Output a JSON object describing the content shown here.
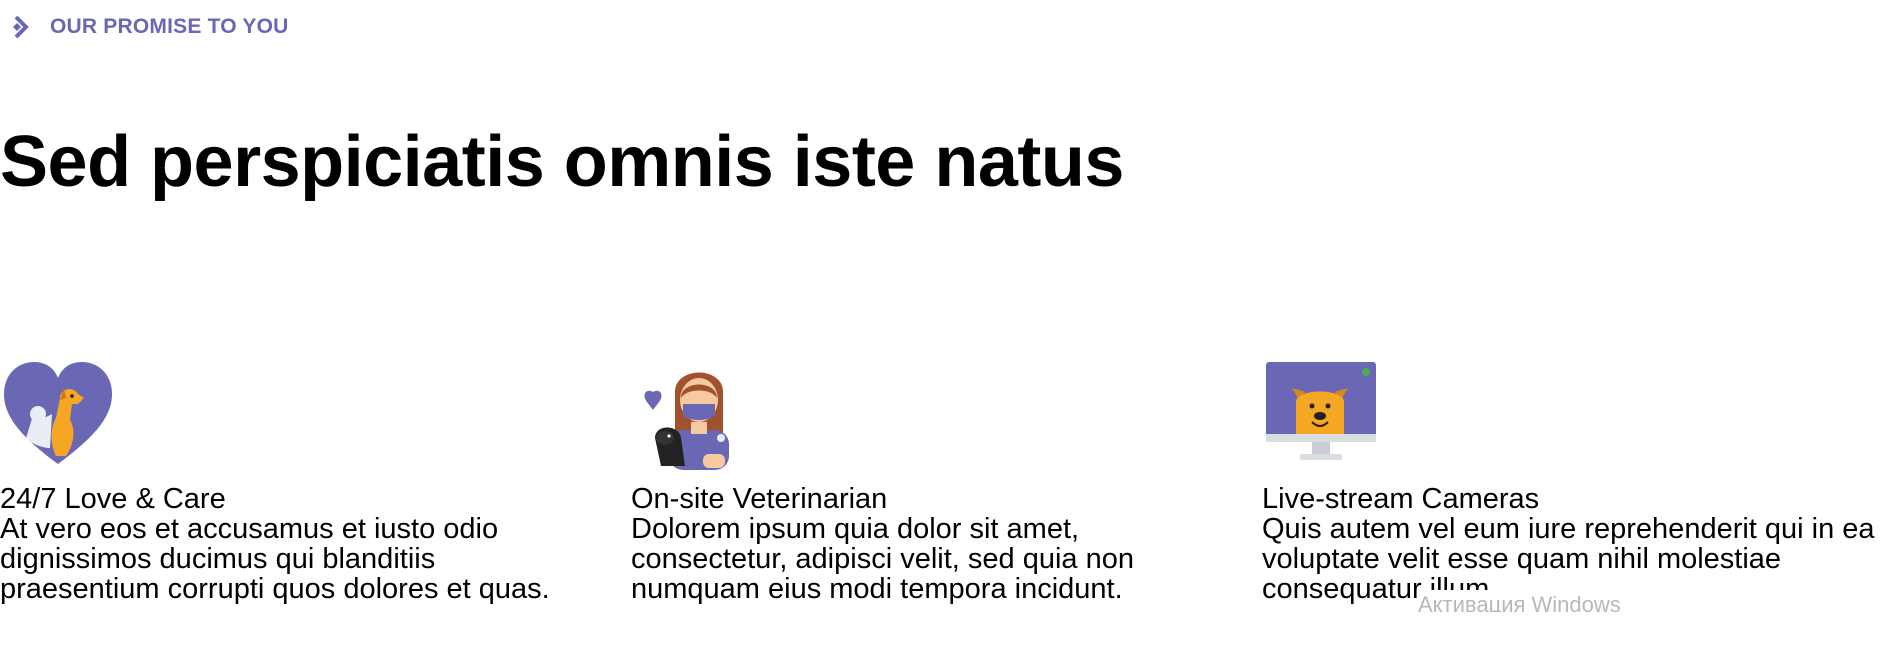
{
  "eyebrow": {
    "label": "OUR PROMISE TO YOU",
    "icon": "diamond-chevron-icon",
    "color": "#6a67b5"
  },
  "headline": "Sed perspiciatis omnis iste natus",
  "features": [
    {
      "icon": "heart-pets-icon",
      "title": "24/7 Love & Care",
      "text": "At vero eos et accusamus et iusto odio dignissimos ducimus qui blanditiis praesentium corrupti quos dolores et quas."
    },
    {
      "icon": "veterinarian-icon",
      "title": "On-site Veterinarian",
      "text": "Dolorem ipsum quia dolor sit amet, consectetur, adipisci velit, sed quia non numquam eius modi tempora incidunt."
    },
    {
      "icon": "monitor-dog-icon",
      "title": "Live-stream Cameras",
      "text": "Quis autem vel eum iure reprehenderit qui in ea voluptate velit esse quam nihil molestiae consequatur illum"
    }
  ],
  "watermark": "Активация Windows",
  "colors": {
    "accent": "#6a67b5",
    "pet_orange": "#f5a623"
  }
}
